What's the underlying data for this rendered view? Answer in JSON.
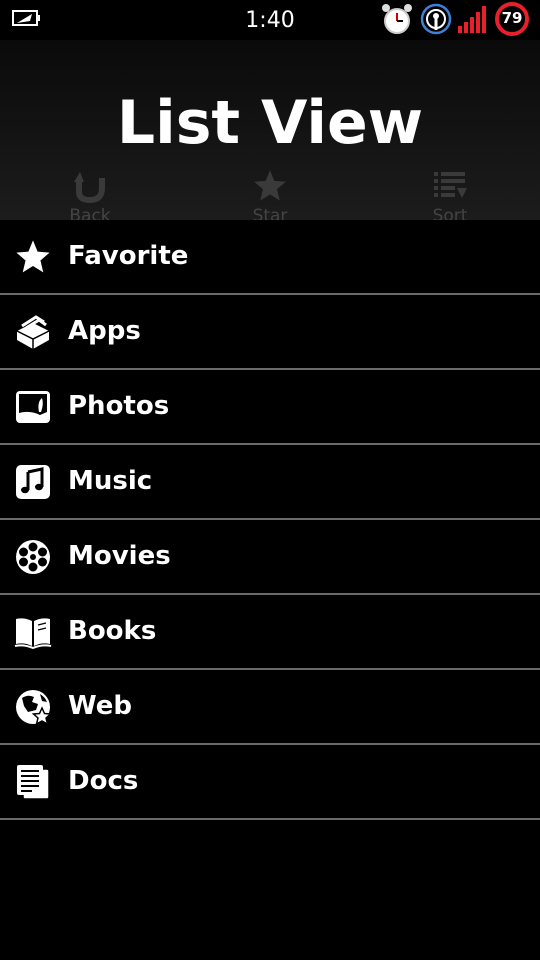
{
  "status_bar": {
    "time": "1:40",
    "battery_level": "79",
    "icons": [
      "battery-saver-icon",
      "alarm-clock-icon",
      "hotspot-icon",
      "signal-bars-icon",
      "battery-ring-icon"
    ]
  },
  "header": {
    "title": "List View",
    "actions": [
      {
        "label": "Back",
        "icon": "back-arrow-icon"
      },
      {
        "label": "Star",
        "icon": "star-icon"
      },
      {
        "label": "Sort",
        "icon": "sort-icon"
      }
    ]
  },
  "list": {
    "items": [
      {
        "label": "Favorite",
        "icon": "star-icon"
      },
      {
        "label": "Apps",
        "icon": "apps-stack-icon"
      },
      {
        "label": "Photos",
        "icon": "photo-icon"
      },
      {
        "label": "Music",
        "icon": "music-note-icon"
      },
      {
        "label": "Movies",
        "icon": "film-reel-icon"
      },
      {
        "label": "Books",
        "icon": "open-book-icon"
      },
      {
        "label": "Web",
        "icon": "globe-star-icon"
      },
      {
        "label": "Docs",
        "icon": "document-icon"
      }
    ]
  },
  "colors": {
    "background": "#000000",
    "separator": "#6a6a6a",
    "signal_red": "#e8202a",
    "hotspot_blue": "#3f7fd8"
  }
}
